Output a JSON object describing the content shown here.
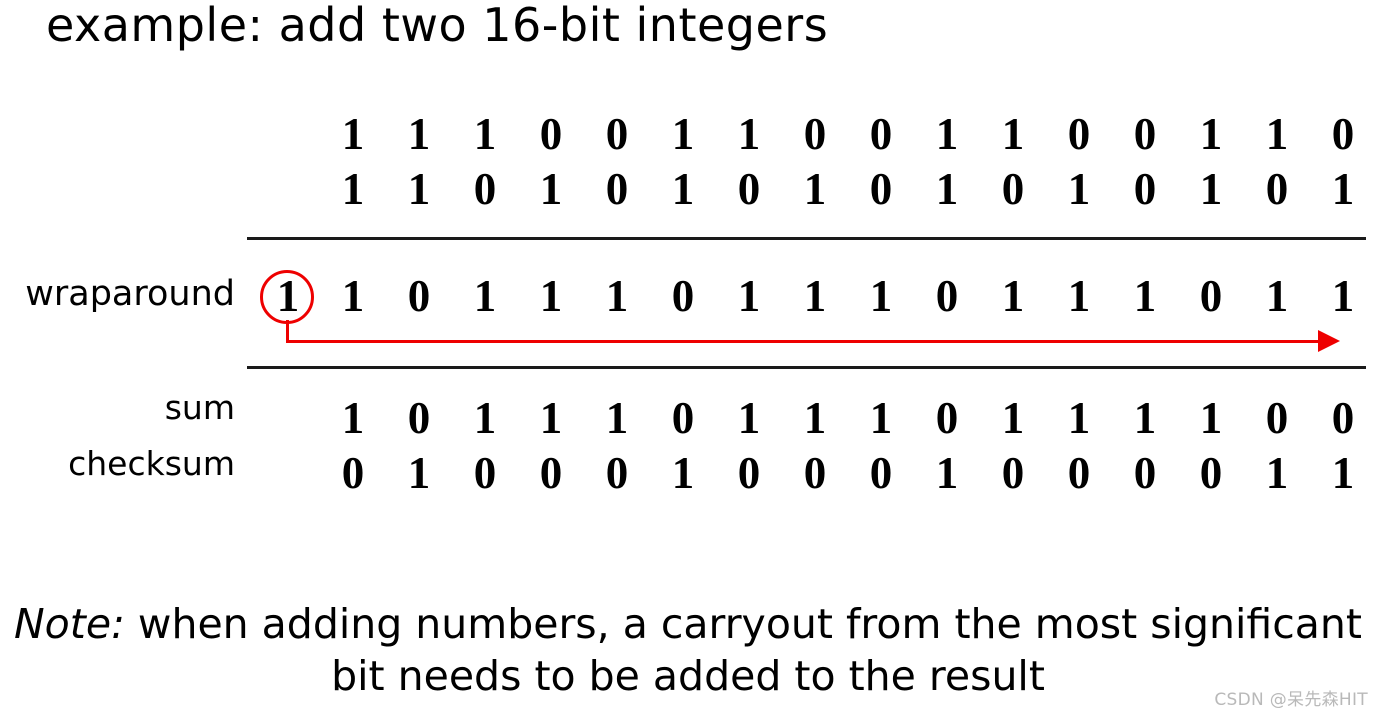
{
  "slide": {
    "title": "example: add two 16-bit integers",
    "note_lead": "Note:",
    "note_text": " when adding numbers, a carryout from the most significant bit needs to be added to the result",
    "watermark": "CSDN @呆先森HIT",
    "accent_color": "#ee0000",
    "rule_color": "#1a1a1a",
    "text_color": "#000000"
  },
  "labels": {
    "wraparound": "wraparound",
    "sum": "sum",
    "checksum": "checksum"
  },
  "binary": {
    "bit_width": 16,
    "addend1": [
      "1",
      "1",
      "1",
      "0",
      "0",
      "1",
      "1",
      "0",
      "0",
      "1",
      "1",
      "0",
      "0",
      "1",
      "1",
      "0"
    ],
    "addend2": [
      "1",
      "1",
      "0",
      "1",
      "0",
      "1",
      "0",
      "1",
      "0",
      "1",
      "0",
      "1",
      "0",
      "1",
      "0",
      "1"
    ],
    "carry_out": "1",
    "wraparound_row": [
      "1",
      "0",
      "1",
      "1",
      "1",
      "0",
      "1",
      "1",
      "1",
      "0",
      "1",
      "1",
      "1",
      "0",
      "1",
      "1"
    ],
    "sum": [
      "1",
      "0",
      "1",
      "1",
      "1",
      "0",
      "1",
      "1",
      "1",
      "0",
      "1",
      "1",
      "1",
      "1",
      "0",
      "0"
    ],
    "checksum": [
      "0",
      "1",
      "0",
      "0",
      "0",
      "1",
      "0",
      "0",
      "0",
      "1",
      "0",
      "0",
      "0",
      "0",
      "1",
      "1"
    ]
  }
}
